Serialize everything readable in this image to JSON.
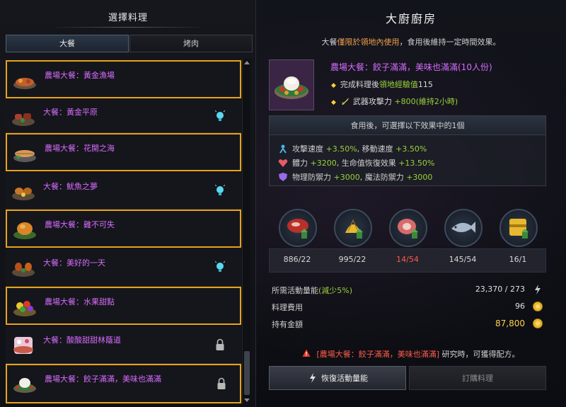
{
  "left": {
    "title": "選擇料理",
    "tabs": [
      {
        "label": "大餐",
        "active": true
      },
      {
        "label": "烤肉",
        "active": false
      }
    ],
    "items": [
      {
        "name": "農場大餐：黃金漁場",
        "highlighted": true,
        "badge": "none",
        "icon": "fish-platter-icon"
      },
      {
        "name": "大餐：黃金平原",
        "highlighted": false,
        "badge": "bulb",
        "icon": "meat-platter-icon"
      },
      {
        "name": "農場大餐：花開之海",
        "highlighted": true,
        "badge": "none",
        "icon": "seafood-platter-icon"
      },
      {
        "name": "大餐：魷魚之夢",
        "highlighted": false,
        "badge": "bulb",
        "icon": "chicken-platter-icon"
      },
      {
        "name": "農場大餐：雞不可失",
        "highlighted": true,
        "badge": "none",
        "icon": "roast-chicken-icon"
      },
      {
        "name": "大餐：美好的一天",
        "highlighted": false,
        "badge": "bulb",
        "icon": "drumstick-platter-icon"
      },
      {
        "name": "農場大餐：水果甜點",
        "highlighted": true,
        "badge": "none",
        "icon": "fruit-platter-icon"
      },
      {
        "name": "大餐：酸酸甜甜林蔭道",
        "highlighted": false,
        "badge": "lock",
        "icon": "dessert-platter-icon"
      },
      {
        "name": "農場大餐：餃子滿滿，美味也滿滿",
        "highlighted": true,
        "badge": "lock",
        "icon": "dumpling-platter-icon"
      }
    ]
  },
  "right": {
    "title": "大廚廚房",
    "subtitle_a": "大餐",
    "subtitle_b": "僅限於領地內使用",
    "subtitle_c": "，食用後維持一定時間效果。",
    "dish_name": "農場大餐：餃子滿滿，美味也滿滿(10人份)",
    "bonus1_a": "完成料理後",
    "bonus1_b": "領地經驗值",
    "bonus1_c": "115",
    "bonus2_a": "武器攻擊力",
    "bonus2_b": "+800",
    "bonus2_c": "(維持2小時)",
    "effect_header": "食用後，可選擇以下效果中的1個",
    "effects": [
      {
        "a": "攻擊速度",
        "b": "+3.50%",
        "c": ", 移動速度",
        "d": "+3.50%"
      },
      {
        "a": "體力",
        "b": "+3200",
        "c": ", 生命值恢復效果",
        "d": "+13.50%"
      },
      {
        "a": "物理防禦力",
        "b": "+3000",
        "c": ", 魔法防禦力",
        "d": "+3000"
      }
    ],
    "ingredients": [
      {
        "icon": "steak-icon",
        "count": "886/22",
        "color": "#d8d8d8"
      },
      {
        "icon": "grain-icon",
        "count": "995/22",
        "color": "#d8d8d8"
      },
      {
        "icon": "ham-icon",
        "count": "14/54",
        "color": "#ff5a4a"
      },
      {
        "icon": "fish-icon",
        "count": "145/54",
        "color": "#d8d8d8"
      },
      {
        "icon": "gold-box-icon",
        "count": "16/1",
        "color": "#d8d8d8"
      }
    ],
    "energy_label_a": "所需活動量能",
    "energy_label_b": "(減少5%)",
    "energy_value": "23,370 / 273",
    "cost_label": "料理費用",
    "cost_value": "96",
    "gold_label": "持有金額",
    "gold_value": "87,800",
    "warning_a": "[農場大餐：餃子滿滿，美味也滿滿]",
    "warning_b": " 研究時，可獲得配方。",
    "btn_restore": "恢復活動量能",
    "btn_order": "訂購料理"
  },
  "colors": {
    "highlight": "#e9a21a",
    "item_name": "#d66bff",
    "green": "#9ad23a",
    "red": "#ff5a4a",
    "gold": "#ffd24a"
  }
}
